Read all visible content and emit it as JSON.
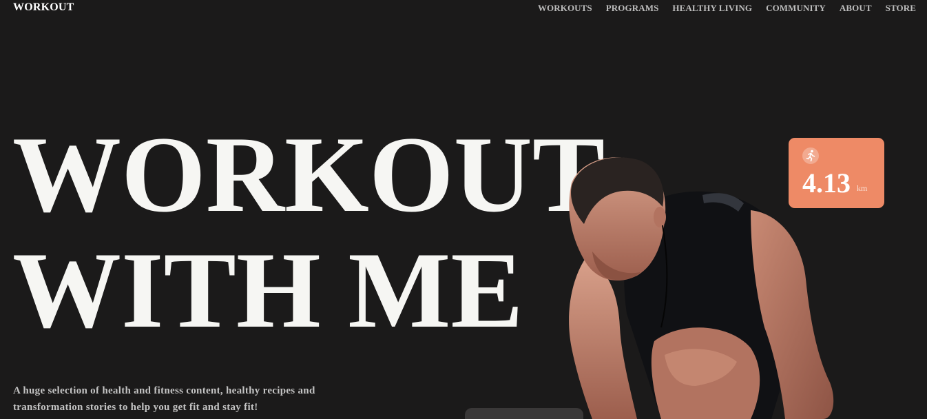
{
  "brand": {
    "name": "WORKOUT"
  },
  "nav": {
    "items": [
      {
        "label": "WORKOUTS"
      },
      {
        "label": "PROGRAMS"
      },
      {
        "label": "HEALTHY LIVING"
      },
      {
        "label": "COMMUNITY"
      },
      {
        "label": "ABOUT"
      },
      {
        "label": "STORE"
      }
    ]
  },
  "hero": {
    "title_line1": "WORKOUT",
    "title_line2": "WITH ME",
    "tagline": "A huge selection of health and fitness content, healthy recipes and transformation stories to help you get fit and stay fit!"
  },
  "stat": {
    "icon": "running-icon",
    "value": "4.13",
    "unit": "km"
  },
  "colors": {
    "background": "#1b1a1a",
    "accent": "#ee8a66",
    "headline": "#f6f6f3"
  }
}
